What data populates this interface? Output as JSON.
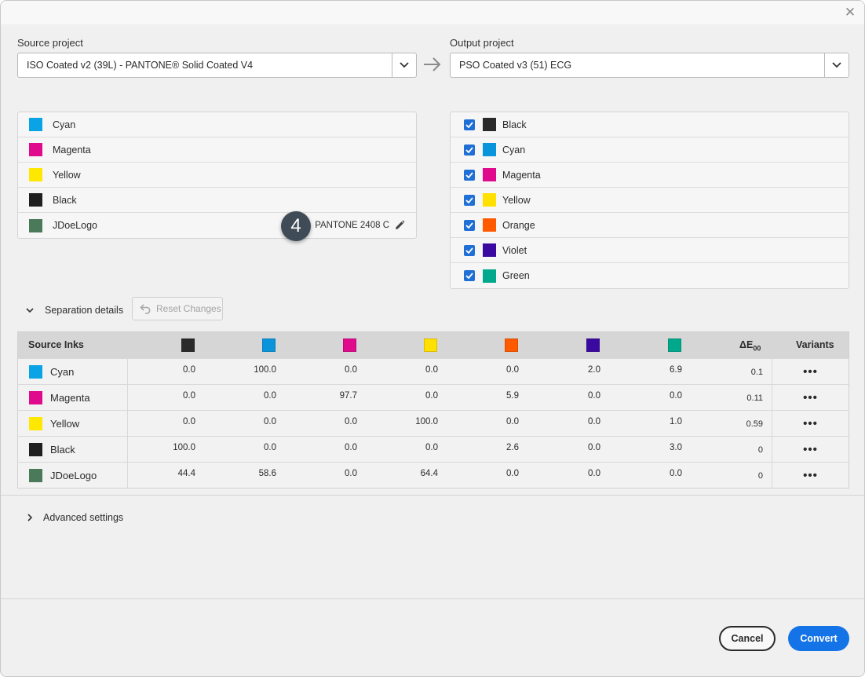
{
  "dialog": {
    "close_label": "✕"
  },
  "source": {
    "label": "Source project",
    "value": "ISO Coated v2 (39L) - PANTONE® Solid Coated V4"
  },
  "output": {
    "label": "Output project",
    "value": "PSO Coated v3 (51) ECG"
  },
  "source_inks": [
    {
      "name": "Cyan",
      "color": "#0aa3e6"
    },
    {
      "name": "Magenta",
      "color": "#e00a8c"
    },
    {
      "name": "Yellow",
      "color": "#ffe800"
    },
    {
      "name": "Black",
      "color": "#1f1f1f"
    },
    {
      "name": "JDoeLogo",
      "color": "#4a7a5a"
    }
  ],
  "mapping": {
    "badge": "4",
    "text": "PANTONE 2408 C"
  },
  "output_inks": [
    {
      "name": "Black",
      "color": "#2a2a2a",
      "checked": true
    },
    {
      "name": "Cyan",
      "color": "#0a94dc",
      "checked": true
    },
    {
      "name": "Magenta",
      "color": "#e00a8c",
      "checked": true
    },
    {
      "name": "Yellow",
      "color": "#ffe000",
      "checked": true
    },
    {
      "name": "Orange",
      "color": "#ff5a00",
      "checked": true
    },
    {
      "name": "Violet",
      "color": "#3a0aa0",
      "checked": true
    },
    {
      "name": "Green",
      "color": "#00a88c",
      "checked": true
    }
  ],
  "separation": {
    "toggle_label": "Separation details",
    "reset_label": "Reset Changes",
    "col_source": "Source Inks",
    "col_de": "ΔE",
    "col_de_sub": "00",
    "col_variants": "Variants",
    "variants_label": "•••",
    "rows": [
      {
        "name": "Cyan",
        "color": "#0aa3e6",
        "values": [
          "0.0",
          "100.0",
          "0.0",
          "0.0",
          "0.0",
          "2.0",
          "6.9"
        ],
        "de": "0.1"
      },
      {
        "name": "Magenta",
        "color": "#e00a8c",
        "values": [
          "0.0",
          "0.0",
          "97.7",
          "0.0",
          "5.9",
          "0.0",
          "0.0"
        ],
        "de": "0.11"
      },
      {
        "name": "Yellow",
        "color": "#ffe800",
        "values": [
          "0.0",
          "0.0",
          "0.0",
          "100.0",
          "0.0",
          "0.0",
          "1.0"
        ],
        "de": "0.59"
      },
      {
        "name": "Black",
        "color": "#1f1f1f",
        "values": [
          "100.0",
          "0.0",
          "0.0",
          "0.0",
          "2.6",
          "0.0",
          "3.0"
        ],
        "de": "0"
      },
      {
        "name": "JDoeLogo",
        "color": "#4a7a5a",
        "values": [
          "44.4",
          "58.6",
          "0.0",
          "64.4",
          "0.0",
          "0.0",
          "0.0"
        ],
        "de": "0"
      }
    ]
  },
  "advanced": {
    "toggle_label": "Advanced settings"
  },
  "buttons": {
    "cancel": "Cancel",
    "convert": "Convert"
  }
}
